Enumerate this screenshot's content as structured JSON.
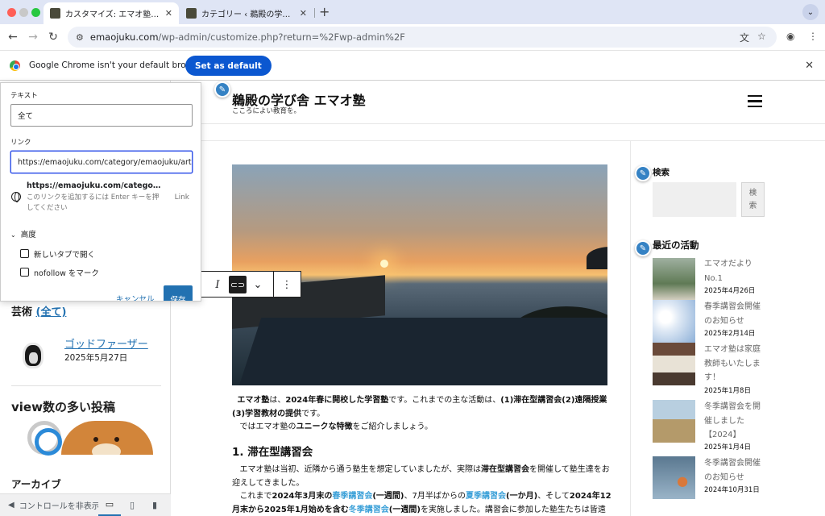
{
  "browser": {
    "tabs": [
      {
        "title": "カスタマイズ: エマオ塾へようこそ",
        "close": "✕"
      },
      {
        "title": "カテゴリー ‹ 鵜殿の学び舎 エマオ塾",
        "close": "✕"
      }
    ],
    "new_tab": "+",
    "tab_menu": "⌄",
    "url_host": "emaojuku.com",
    "url_path": "/wp-admin/customize.php?return=%2Fwp-admin%2F",
    "infobar_text": "Google Chrome isn't your default browser",
    "set_default_label": "Set as default",
    "infobar_close": "✕",
    "icons": {
      "back": "arrow-left-icon",
      "forward": "arrow-right-icon",
      "reload": "reload-icon",
      "site_info": "tune-icon",
      "translate": "translate-icon",
      "bookmark": "star-icon",
      "profile": "profile-icon",
      "menu": "kebab-menu-icon"
    }
  },
  "link_popover": {
    "text_label": "テキスト",
    "text_value": "全て",
    "link_label": "リンク",
    "link_value": "https://emaojuku.com/category/emaojuku/art",
    "suggestion_url": "https://emaojuku.com/category/em...",
    "suggestion_hint": "このリンクを追加するには Enter キーを押してください",
    "suggestion_type": "Link",
    "advanced_label": "高度",
    "open_new_tab_label": "新しいタブで開く",
    "nofollow_label": "nofollow をマーク",
    "cancel_label": "キャンセル",
    "save_label": "保存"
  },
  "block_toolbar": {
    "italic": "I",
    "link": "⊂⊃",
    "more": "⌄",
    "options": "⋮"
  },
  "customizer": {
    "section_art": "芸術",
    "section_art_link": "(全て)",
    "post_title": "ゴッドファーザー",
    "post_date": "2025年5月27日",
    "popular_heading": "view数の多い投稿",
    "archive_heading": "アーカイブ",
    "hide_controls_label": "コントロールを非表示",
    "device_desktop": "desktop-icon",
    "device_tablet": "tablet-icon",
    "device_mobile": "mobile-icon"
  },
  "site": {
    "title": "鵜殿の学び舎 エマオ塾",
    "tagline": "こころによい教育を。",
    "intro": {
      "p1_a": "エマオ塾",
      "p1_b": "は、",
      "p1_c": "2024年春に開校した学習塾",
      "p1_d": "です。これまでの主な活動は、",
      "p1_e": "(1)滞在型講習会(2)遠隔授業(3)学習教材の提供",
      "p1_f": "です。",
      "p2_a": "では",
      "p2_b": "エマオ塾",
      "p2_c": "の",
      "p2_d": "ユニークな特徴",
      "p2_e": "をご紹介しましょう。"
    },
    "h2": "1. 滞在型講習会",
    "body": {
      "p3_a": "エマオ塾は当初、近隣から通う塾生を想定していましたが、実際は",
      "p3_b": "滞在型講習会",
      "p3_c": "を開催して塾生達をお迎えしてきました。",
      "p4_a": "これまで",
      "p4_b": "2024年3月末の",
      "p4_c": "春季講習会",
      "p4_d": "(一週間)",
      "p4_e": "、7月半ばからの",
      "p4_f": "夏季講習会",
      "p4_g": "(一か月)",
      "p4_h": "、そして",
      "p4_i": "2024年12月末から2025年1月始めを含む",
      "p4_j": "冬季講習会",
      "p4_k": "(一週間)",
      "p4_l": "を実施しました。講習会に参加した塾生たちは皆遠方か"
    },
    "sidebar": {
      "search_heading": "検索",
      "search_button": "検索",
      "recent_heading": "最近の活動",
      "activities": [
        {
          "title": "エマオだよりNo.1",
          "date": "2025年4月26日"
        },
        {
          "title": "春季講習会開催のお知らせ",
          "date": "2025年2月14日"
        },
        {
          "title": "エマオ塾は家庭教師もいたします！",
          "date": "2025年1月8日"
        },
        {
          "title": "冬季講習会を開催しました【2024】",
          "date": "2025年1月4日"
        },
        {
          "title": "冬季講習会開催のお知らせ",
          "date": "2024年10月31日"
        }
      ]
    }
  }
}
